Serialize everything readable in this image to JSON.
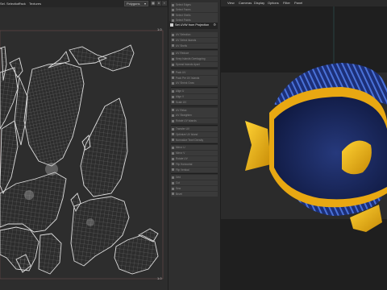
{
  "uv_editor": {
    "menu": [
      "Sel. Selection",
      "Pack",
      "Textures"
    ],
    "mode_select": "Polygons",
    "corner_labels": {
      "top_right": "1.0",
      "bottom_right": "1.0"
    }
  },
  "tools": {
    "items_top": [
      "Select Edges",
      "Select Faces",
      "Select Shells",
      "Select Points"
    ],
    "active": "Set UVW from Projection",
    "items_bottom": [
      "UV Selection",
      "UV Select Islands",
      "UV Shells",
      "UV Reduce",
      "Keep Islands Overlapping",
      "Spread Islands Apart",
      "Pack UV",
      "Pack Per UV Islands",
      "UV Shrink Grow",
      "Align U",
      "Align V",
      "Scale UV",
      "UV Relax",
      "UV Straighten",
      "Rotate UV Islands",
      "Transfer UV",
      "Optimize UV Island",
      "Normalize Texel Density",
      "Mirror U",
      "Mirror V",
      "Rotate UV",
      "Flip Horizontal",
      "Flip Vertical",
      "Grid",
      "Cut",
      "Sew",
      "Bevel"
    ]
  },
  "viewport": {
    "menu": [
      "View",
      "Cameras",
      "Display",
      "Options",
      "Filter",
      "Panel"
    ]
  },
  "colors": {
    "fish_blue": "#1d2f6b",
    "fish_yellow": "#f2b214",
    "fish_stripe": "#3f63c8",
    "uv_line": "#d8d8d8",
    "panel_bg": "#2d2d2d"
  }
}
